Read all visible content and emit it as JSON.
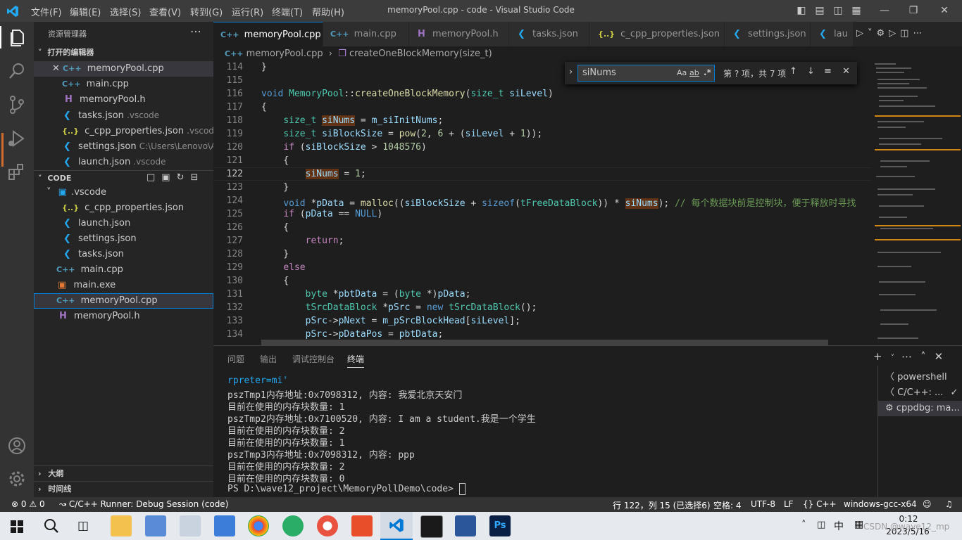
{
  "window": {
    "title": "memoryPool.cpp - code - Visual Studio Code",
    "menus": [
      "文件(F)",
      "编辑(E)",
      "选择(S)",
      "查看(V)",
      "转到(G)",
      "运行(R)",
      "终端(T)",
      "帮助(H)"
    ]
  },
  "sidebar": {
    "header": "资源管理器",
    "open_editors_title": "打开的编辑器",
    "open_editors": [
      {
        "name": "memoryPool.cpp",
        "detail": ""
      },
      {
        "name": "main.cpp",
        "detail": ""
      },
      {
        "name": "memoryPool.h",
        "detail": ""
      },
      {
        "name": "tasks.json",
        "detail": ".vscode"
      },
      {
        "name": "c_cpp_properties.json",
        "detail": ".vscode"
      },
      {
        "name": "settings.json",
        "detail": "C:\\Users\\Lenovo\\Ap..."
      },
      {
        "name": "launch.json",
        "detail": ".vscode"
      }
    ],
    "folder_title": "CODE",
    "tree": [
      {
        "name": ".vscode"
      },
      {
        "name": "c_cpp_properties.json"
      },
      {
        "name": "launch.json"
      },
      {
        "name": "settings.json"
      },
      {
        "name": "tasks.json"
      },
      {
        "name": "main.cpp"
      },
      {
        "name": "main.exe"
      },
      {
        "name": "memoryPool.cpp"
      },
      {
        "name": "memoryPool.h"
      }
    ],
    "outline_title": "大纲",
    "timeline_title": "时间线"
  },
  "tabs": [
    "memoryPool.cpp",
    "main.cpp",
    "memoryPool.h",
    "tasks.json",
    "c_cpp_properties.json",
    "settings.json",
    "lau"
  ],
  "breadcrumb": {
    "file": "memoryPool.cpp",
    "symbol": "createOneBlockMemory(size_t)"
  },
  "find": {
    "query": "siNums",
    "opt_case": "Aa",
    "opt_word": "ab",
    "opt_regex": ".*",
    "result": "第 ? 项，共 7 项"
  },
  "editor": {
    "line_numbers": [
      "114",
      "115",
      "116",
      "117",
      "118",
      "119",
      "120",
      "121",
      "122",
      "123",
      "124",
      "125",
      "126",
      "127",
      "128",
      "129",
      "130",
      "131",
      "132",
      "133",
      "134"
    ],
    "lines": [
      "}",
      "",
      "void MemoryPool::createOneBlockMemory(size_t siLevel)",
      "{",
      "    size_t siNums = m_siInitNums;",
      "    size_t siBlockSize = pow(2, 6 + (siLevel + 1));",
      "    if (siBlockSize > 1048576)",
      "    {",
      "        siNums = 1;",
      "    }",
      "    void *pData = malloc((siBlockSize + sizeof(tFreeDataBlock)) * siNums); // 每个数据块前是控制块，便于释放时寻找",
      "    if (pData == NULL)",
      "    {",
      "        return;",
      "    }",
      "    else",
      "    {",
      "        byte *pbtData = (byte *)pData;",
      "        tSrcDataBlock *pSrc = new tSrcDataBlock();",
      "        pSrc->pNext = m_pSrcBlockHead[siLevel];",
      "        pSrc->pDataPos = pbtData;"
    ]
  },
  "panel": {
    "tabs": [
      "问题",
      "输出",
      "调试控制台",
      "终端"
    ],
    "terminal_lines": [
      "rpreter=mi'",
      "pszTmp1内存地址:0x7098312, 内容: 我爱北京天安门",
      "目前在使用的内存块数量: 1",
      "pszTmp2内存地址:0x7100520, 内容: I am a student.我是一个学生",
      "目前在使用的内存块数量: 2",
      "目前在使用的内存块数量: 1",
      "pszTmp3内存地址:0x7098312, 内容: ppp",
      "目前在使用的内存块数量: 2",
      "目前在使用的内存块数量: 0",
      "PS D:\\wave12_project\\MemoryPollDemo\\code> "
    ],
    "terminals": [
      "powershell",
      "C/C++: ...",
      "cppdbg: ma..."
    ]
  },
  "status": {
    "errors": "0",
    "warnings": "0",
    "runner": "C/C++ Runner: Debug Session (code)",
    "position": "行 122，列 15 (已选择6)",
    "spaces": "空格: 4",
    "encoding": "UTF-8",
    "eol": "LF",
    "language": "C++",
    "config": "windows-gcc-x64"
  },
  "taskbar": {
    "time": "0:12",
    "date": "2023/5/16",
    "ime": "中",
    "watermark": "CSDN @wave12_mp"
  },
  "colors": {
    "accent": "#007acc",
    "keyword": "#569cd6",
    "type": "#4ec9b0",
    "function": "#dcdcaa",
    "variable": "#9cdcfe",
    "number": "#b5cea8",
    "comment": "#6a9955",
    "control": "#c586c0",
    "find_highlight": "#613214"
  }
}
